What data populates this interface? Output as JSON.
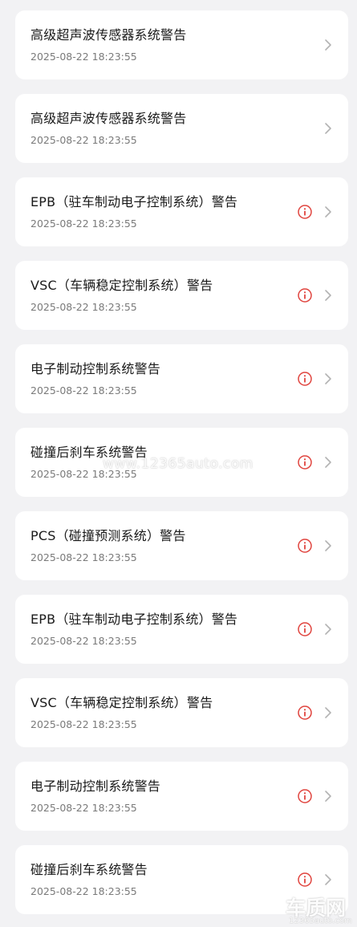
{
  "colors": {
    "background": "#f2f2f4",
    "card": "#ffffff",
    "title": "#1a1a1a",
    "timestamp": "#7a7a7a",
    "warning": "#e0443e",
    "chevron": "#b3b3b3"
  },
  "alerts": [
    {
      "title": "高级超声波传感器系统警告",
      "time": "2025-08-22 18:23:55",
      "warning_icon": false
    },
    {
      "title": "高级超声波传感器系统警告",
      "time": "2025-08-22 18:23:55",
      "warning_icon": false
    },
    {
      "title": "EPB（驻车制动电子控制系统）警告",
      "time": "2025-08-22 18:23:55",
      "warning_icon": true
    },
    {
      "title": "VSC（车辆稳定控制系统）警告",
      "time": "2025-08-22 18:23:55",
      "warning_icon": true
    },
    {
      "title": "电子制动控制系统警告",
      "time": "2025-08-22 18:23:55",
      "warning_icon": true
    },
    {
      "title": "碰撞后刹车系统警告",
      "time": "2025-08-22 18:23:55",
      "warning_icon": true
    },
    {
      "title": "PCS（碰撞预测系统）警告",
      "time": "2025-08-22 18:23:55",
      "warning_icon": true
    },
    {
      "title": "EPB（驻车制动电子控制系统）警告",
      "time": "2025-08-22 18:23:55",
      "warning_icon": true
    },
    {
      "title": "VSC（车辆稳定控制系统）警告",
      "time": "2025-08-22 18:23:55",
      "warning_icon": true
    },
    {
      "title": "电子制动控制系统警告",
      "time": "2025-08-22 18:23:55",
      "warning_icon": true
    },
    {
      "title": "碰撞后刹车系统警告",
      "time": "2025-08-22 18:23:55",
      "warning_icon": true
    }
  ],
  "watermark": {
    "text": "www.12365auto.com",
    "logo_text": "车质网",
    "logo_url": "12365auto.com"
  }
}
